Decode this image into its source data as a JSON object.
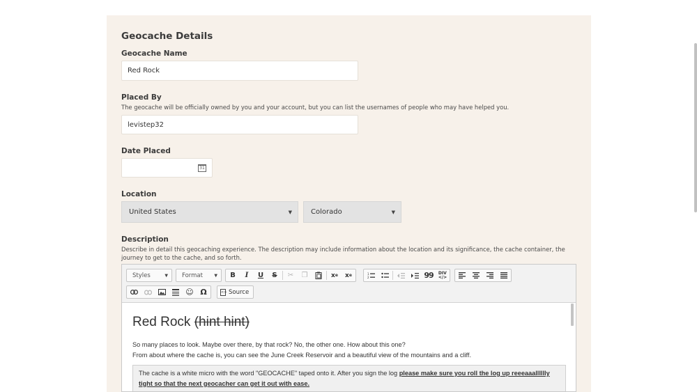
{
  "form": {
    "title": "Geocache Details",
    "name": {
      "label": "Geocache Name",
      "value": "Red Rock"
    },
    "placed_by": {
      "label": "Placed By",
      "help": "The geocache will be officially owned by you and your account, but you can list the usernames of people who may have helped you.",
      "value": "levistep32"
    },
    "date_placed": {
      "label": "Date Placed",
      "value": "",
      "calendar_icon_text": "31"
    },
    "location": {
      "label": "Location",
      "country": "United States",
      "state": "Colorado"
    },
    "description": {
      "label": "Description",
      "help_line1": "Describe in detail this geocaching experience. The description may include information about the location and its significance, the cache container, the",
      "help_line2": "journey to get to the cache, and so forth."
    }
  },
  "editor": {
    "toolbar": {
      "styles_label": "Styles",
      "format_label": "Format",
      "bold": "B",
      "italic": "I",
      "underline": "U",
      "strike": "S",
      "blockquote": "99",
      "special_char": "Ω",
      "source_label": "Source"
    },
    "content": {
      "heading": "Red Rock",
      "heading_strike": "(hint hint)",
      "para_line1": "So many places to look. Maybe over there, by that rock? No, the other one. How about this one?",
      "para_line2": "From about where the cache is, you can see the June Creek Reservoir and a beautiful view of the mountains and a cliff.",
      "hint_plain": "The cache is a white micro with the word \"GEOCACHE\" taped onto it. After you sign the log ",
      "hint_emphasis": "please make sure you roll the log up reeeaaalllllly tight so that the next geocacher can get it out with ease."
    }
  },
  "colors": {
    "panel_bg": "#f7f1ea",
    "select_bg": "#e3e3e3",
    "toolbar_bg": "#f2f2f2"
  }
}
